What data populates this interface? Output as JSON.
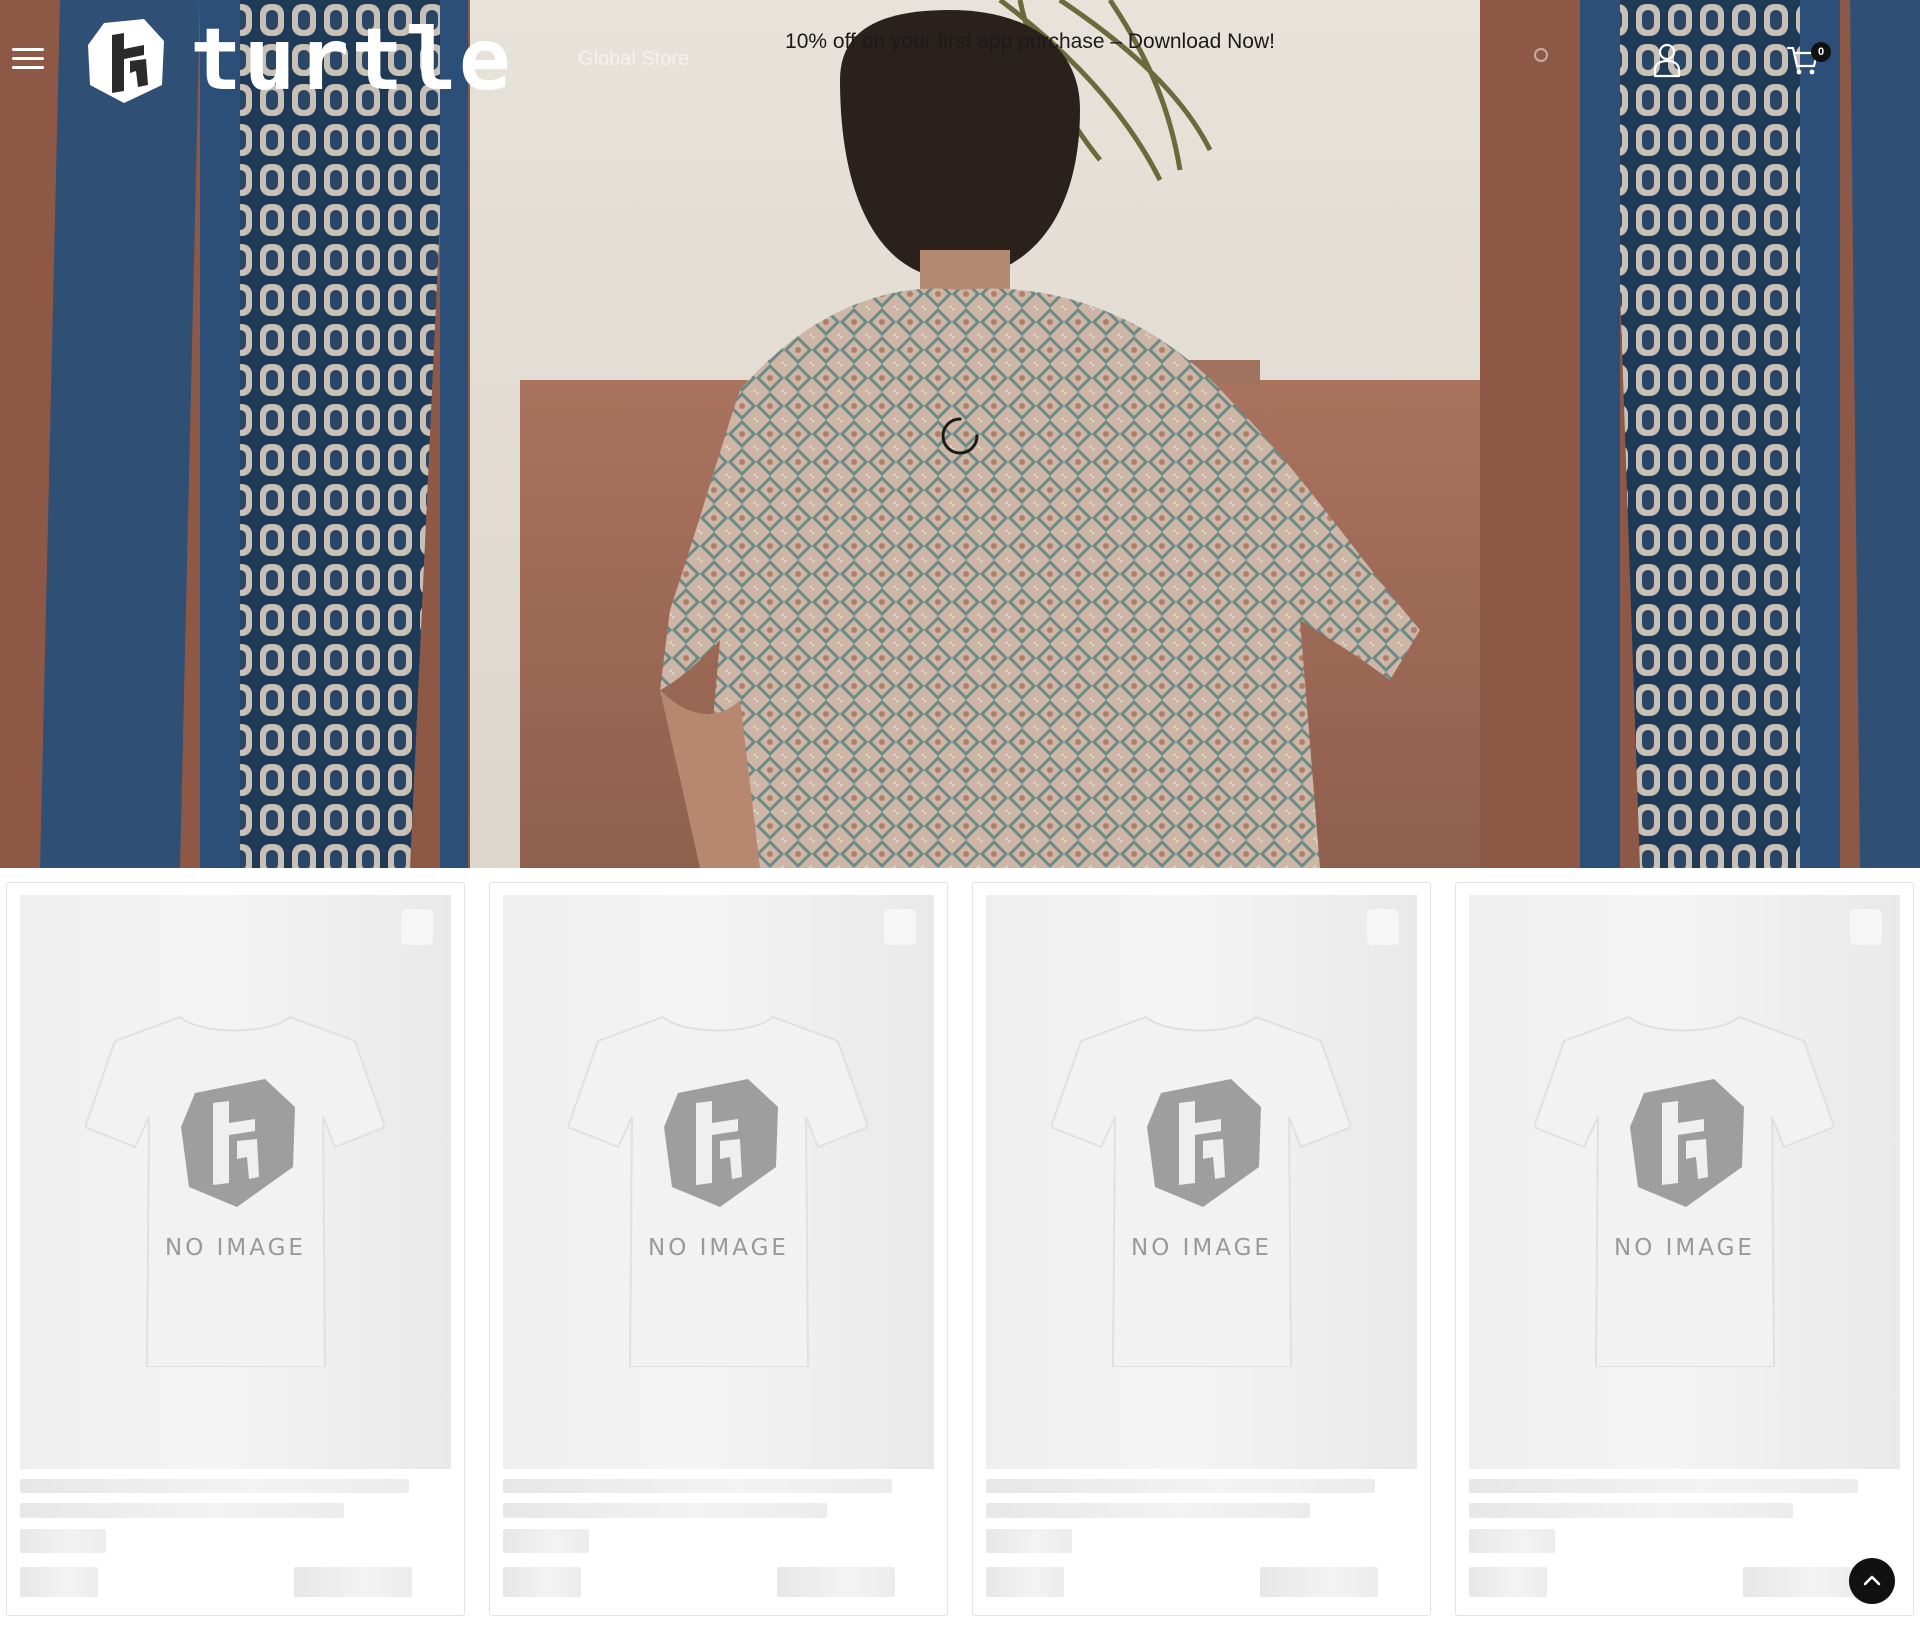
{
  "header": {
    "announcement": "10% off on your first app purchase – Download Now!",
    "logo_text": "turtle",
    "nav_link": "Global Store",
    "cart_count": "0"
  },
  "products": [
    {
      "placeholder_text": "NO IMAGE"
    },
    {
      "placeholder_text": "NO IMAGE"
    },
    {
      "placeholder_text": "NO IMAGE"
    },
    {
      "placeholder_text": "NO IMAGE"
    }
  ],
  "icons": {
    "menu": "hamburger-icon",
    "account": "user-icon",
    "cart": "cart-icon",
    "back_to_top": "chevron-up-icon",
    "loading": "spinner-icon"
  },
  "colors": {
    "text": "#1a1a1a",
    "skeleton": "#ececec",
    "button": "#111111"
  }
}
